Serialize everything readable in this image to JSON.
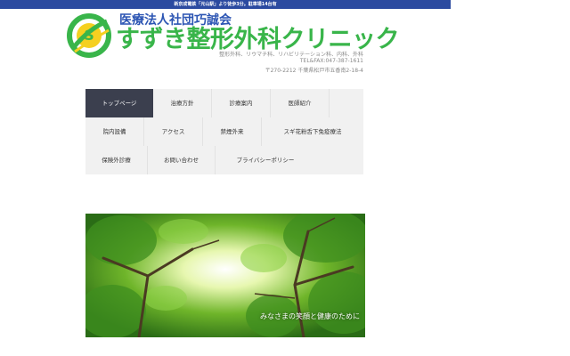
{
  "top_notice": "新京成電鉄「元山駅」より徒歩3分。駐車場14台有",
  "header": {
    "org_name": "医療法人社団巧誠会",
    "clinic_name": "すずき整形外科クリニック",
    "departments": "整形外科、リウマチ科、リハビリテーション科、内科、外科",
    "phone": "TEL&FAX:047-387-1611",
    "address": "〒270-2212 千葉県松戸市五香南2-18-4"
  },
  "nav": {
    "rows": [
      [
        {
          "label": "トップページ",
          "active": true
        },
        {
          "label": "治療方針"
        },
        {
          "label": "診療案内"
        },
        {
          "label": "医師紹介"
        }
      ],
      [
        {
          "label": "院内設備"
        },
        {
          "label": "アクセス"
        },
        {
          "label": "禁煙外来"
        },
        {
          "label": "スギ花粉舌下免疫療法"
        }
      ],
      [
        {
          "label": "保険外診療"
        },
        {
          "label": "お問い合わせ"
        },
        {
          "label": "プライバシーポリシー"
        }
      ]
    ]
  },
  "hero": {
    "caption": "みなさまの笑顔と健康のために"
  },
  "colors": {
    "topbar": "#2b4aa0",
    "org_text": "#2c55b3",
    "clinic_text": "#39b54a",
    "nav_bg": "#f1f1f1",
    "nav_active": "#3b3f4e"
  }
}
